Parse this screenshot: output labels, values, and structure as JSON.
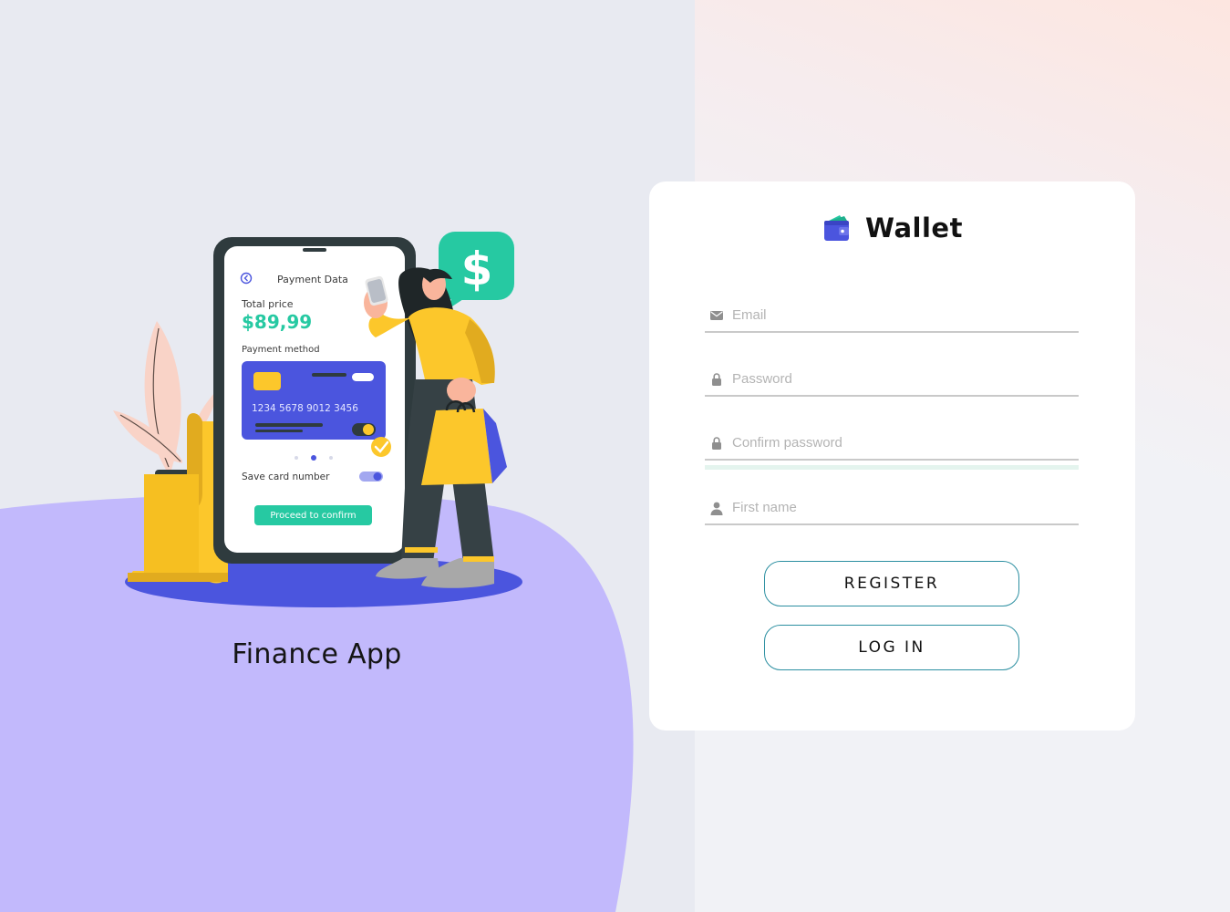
{
  "left_panel": {
    "title": "Finance App",
    "illustration": {
      "screen_title": "Payment Data",
      "total_label": "Total price",
      "total_value": "$89,99",
      "method_label": "Payment method",
      "card_number": "1234  5678  9012  3456",
      "save_label": "Save card number",
      "proceed_label": "Proceed to confirm",
      "badge_symbol": "$"
    }
  },
  "form": {
    "brand": {
      "name": "Wallet",
      "icon": "wallet-icon"
    },
    "fields": {
      "email": {
        "placeholder": "Email",
        "value": "",
        "icon": "mail-icon"
      },
      "password": {
        "placeholder": "Password",
        "value": "",
        "icon": "lock-icon"
      },
      "confirm_password": {
        "placeholder": "Confirm password",
        "value": "",
        "icon": "lock-icon"
      },
      "first_name": {
        "placeholder": "First name",
        "value": "",
        "icon": "user-icon"
      }
    },
    "buttons": {
      "register": "REGISTER",
      "login": "LOG IN"
    }
  },
  "colors": {
    "background": "#e8eaf1",
    "blob": "#c2b9fc",
    "accent_teal": "#26c9a2",
    "accent_blue": "#4b55de",
    "accent_yellow": "#fcc72b",
    "button_border": "#2c8fa1"
  }
}
